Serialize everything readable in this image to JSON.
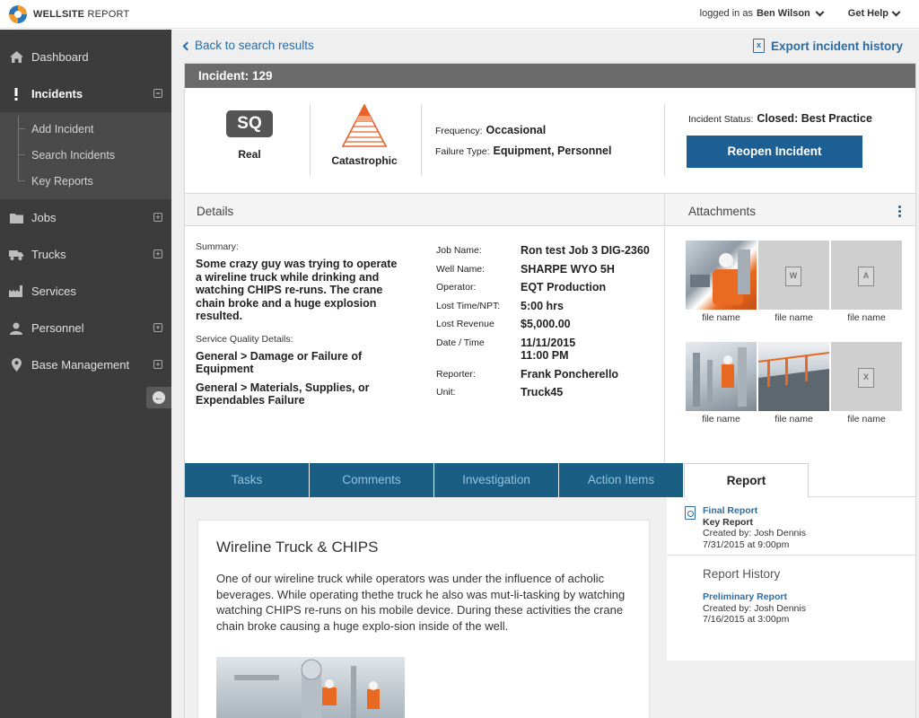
{
  "header": {
    "logo_bold": "WELLSITE",
    "logo_rest": " REPORT",
    "logged_in_prefix": "logged in as",
    "user_name": "Ben Wilson",
    "help_label": "Get Help"
  },
  "sidebar": {
    "items": [
      {
        "label": "Dashboard",
        "icon": "home-icon"
      },
      {
        "label": "Incidents",
        "icon": "exclamation-icon",
        "active": true
      },
      {
        "label": "Jobs",
        "icon": "folder-icon"
      },
      {
        "label": "Trucks",
        "icon": "truck-icon"
      },
      {
        "label": "Services",
        "icon": "factory-icon"
      },
      {
        "label": "Personnel",
        "icon": "person-icon"
      },
      {
        "label": "Base Management",
        "icon": "map-pin-icon"
      }
    ],
    "incidents_sub": [
      "Add Incident",
      "Search Incidents",
      "Key Reports"
    ]
  },
  "nav": {
    "back_label": "Back to search results",
    "export_label": "Export incident history"
  },
  "incident": {
    "title": "Incident: 129",
    "sq_badge": "SQ",
    "sq_label": "Real",
    "severity_label": "Catastrophic",
    "frequency_label": "Frequency:",
    "frequency_value": "Occasional",
    "failure_label": "Failure Type:",
    "failure_value": "Equipment, Personnel",
    "status_label": "Incident Status:",
    "status_value": "Closed: Best Practice",
    "reopen_label": "Reopen Incident"
  },
  "details": {
    "heading": "Details",
    "summary_label": "Summary:",
    "summary_text": "Some crazy guy was trying to operate a wireline truck while drinking and watching CHIPS re-runs. The crane chain broke and a huge explosion resulted.",
    "sq_details_label": "Service Quality Details:",
    "sq_details": [
      "General > Damage or Failure of Equipment",
      "General > Materials, Supplies, or Expendables Failure"
    ],
    "fields": [
      {
        "k": "Job Name:",
        "v": "Ron test Job 3 DIG-2360"
      },
      {
        "k": "Well Name:",
        "v": "SHARPE WYO 5H"
      },
      {
        "k": "Operator:",
        "v": "EQT Production"
      },
      {
        "k": "Lost Time/NPT:",
        "v": "5:00 hrs"
      },
      {
        "k": "Lost Revenue",
        "v": "$5,000.00"
      },
      {
        "k": "Date / Time",
        "v": "11/11/2015",
        "v2": "11:00 PM"
      },
      {
        "k": "Reporter:",
        "v": "Frank Poncherello"
      },
      {
        "k": "Unit:",
        "v": "Truck45"
      }
    ]
  },
  "attachments": {
    "heading": "Attachments",
    "files": [
      {
        "name": "file name",
        "kind": "photo-worker"
      },
      {
        "name": "file name",
        "kind": "word-doc-icon",
        "glyph": "W"
      },
      {
        "name": "file name",
        "kind": "pdf-icon",
        "glyph": "A"
      },
      {
        "name": "file name",
        "kind": "photo-plant"
      },
      {
        "name": "file name",
        "kind": "photo-yard"
      },
      {
        "name": "file name",
        "kind": "excel-icon",
        "glyph": "X"
      }
    ]
  },
  "tabs": [
    "Tasks",
    "Comments",
    "Investigation",
    "Action Items",
    "Report"
  ],
  "report": {
    "title": "Wireline Truck & CHIPS",
    "body": "One of our wireline truck while operators was under the influence of acholic beverages. While operating thethe truck he also was mut-li-tasking by watching watching CHIPS re-runs on his mobile device. During these activities the crane chain broke causing a huge explo-sion inside of the well.",
    "final_link": "Final Report",
    "final_key": "Key Report",
    "final_created": "Created by: Josh Dennis",
    "final_date": "7/31/2015 at 9:00pm",
    "history_heading": "Report History",
    "prelim_link": "Preliminary Report",
    "prelim_created": "Created by: Josh Dennis",
    "prelim_date": "7/16/2015 at 3:00pm"
  },
  "colors": {
    "sidebar": "#3c3c3c",
    "accent_blue": "#1d5f93",
    "tab_blue": "#1b5e84",
    "link_blue": "#2a6ca6",
    "severity_orange": "#e8632a"
  }
}
